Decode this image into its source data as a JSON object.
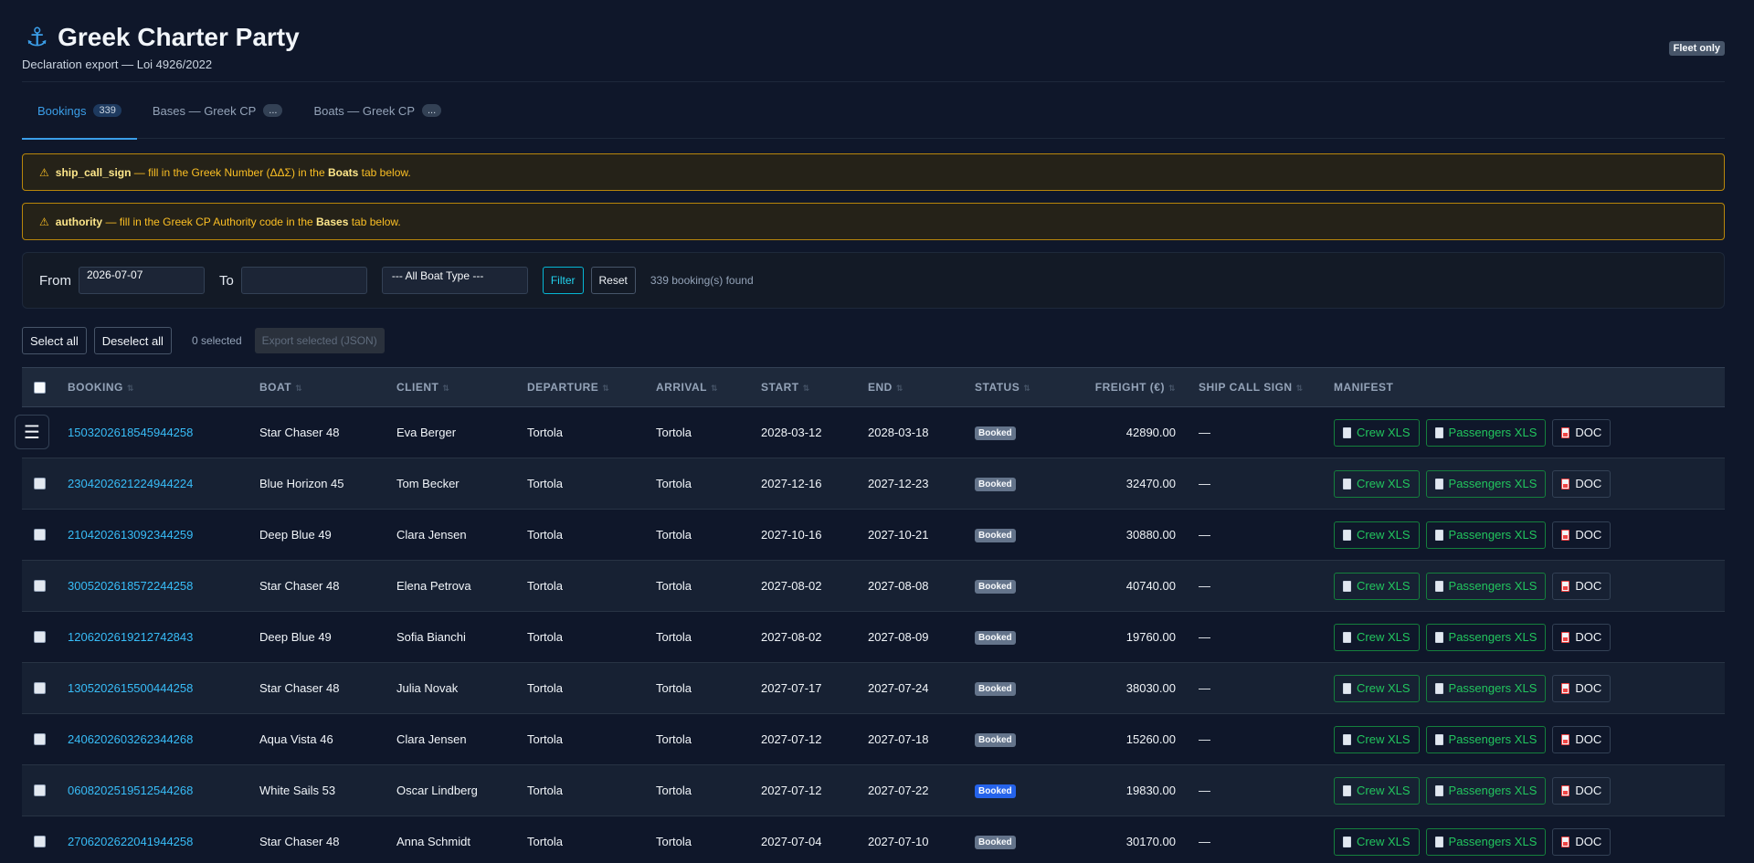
{
  "header": {
    "title": "Greek Charter Party",
    "subtitle": "Declaration export — Loi 4926/2022",
    "badge": "Fleet only",
    "icon": "anchor-icon"
  },
  "tabs": [
    {
      "label": "Bookings",
      "count": "339"
    },
    {
      "label": "Bases — Greek CP",
      "count": "..."
    },
    {
      "label": "Boats — Greek CP",
      "count": "..."
    }
  ],
  "warnings": [
    {
      "field": "ship_call_sign",
      "text_before": " — fill in the Greek Number (ΔΔΣ) in the ",
      "target": "Boats",
      "text_after": " tab below."
    },
    {
      "field": "authority",
      "text_before": " — fill in the Greek CP Authority code in the ",
      "target": "Bases",
      "text_after": " tab below."
    }
  ],
  "filter": {
    "from_label": "From",
    "from_value": "2026-07-07",
    "to_label": "To",
    "to_value": "",
    "boat_type": "--- All Boat Type ---",
    "filter_label": "Filter",
    "reset_label": "Reset",
    "found": "339 booking(s) found"
  },
  "selection": {
    "select_all": "Select all",
    "deselect_all": "Deselect all",
    "selected": "0 selected",
    "export": "Export selected (JSON)"
  },
  "table": {
    "headers": {
      "booking": "BOOKING",
      "boat": "BOAT",
      "client": "CLIENT",
      "departure": "DEPARTURE",
      "arrival": "ARRIVAL",
      "start": "START",
      "end": "END",
      "status": "STATUS",
      "freight": "FREIGHT (€)",
      "sign": "SHIP CALL SIGN",
      "manifest": "MANIFEST"
    },
    "manifest_labels": {
      "crew": "Crew XLS",
      "passengers": "Passengers XLS",
      "doc": "DOC"
    },
    "rows": [
      {
        "booking": "1503202618545944258",
        "boat": "Star Chaser 48",
        "client": "Eva Berger",
        "departure": "Tortola",
        "arrival": "Tortola",
        "start": "2028-03-12",
        "end": "2028-03-18",
        "status": "Booked",
        "status_color": "#64748b",
        "freight": "42890.00",
        "sign": "—"
      },
      {
        "booking": "2304202621224944224",
        "boat": "Blue Horizon 45",
        "client": "Tom Becker",
        "departure": "Tortola",
        "arrival": "Tortola",
        "start": "2027-12-16",
        "end": "2027-12-23",
        "status": "Booked",
        "status_color": "#64748b",
        "freight": "32470.00",
        "sign": "—"
      },
      {
        "booking": "2104202613092344259",
        "boat": "Deep Blue 49",
        "client": "Clara Jensen",
        "departure": "Tortola",
        "arrival": "Tortola",
        "start": "2027-10-16",
        "end": "2027-10-21",
        "status": "Booked",
        "status_color": "#64748b",
        "freight": "30880.00",
        "sign": "—"
      },
      {
        "booking": "3005202618572244258",
        "boat": "Star Chaser 48",
        "client": "Elena Petrova",
        "departure": "Tortola",
        "arrival": "Tortola",
        "start": "2027-08-02",
        "end": "2027-08-08",
        "status": "Booked",
        "status_color": "#64748b",
        "freight": "40740.00",
        "sign": "—"
      },
      {
        "booking": "1206202619212742843",
        "boat": "Deep Blue 49",
        "client": "Sofia Bianchi",
        "departure": "Tortola",
        "arrival": "Tortola",
        "start": "2027-08-02",
        "end": "2027-08-09",
        "status": "Booked",
        "status_color": "#64748b",
        "freight": "19760.00",
        "sign": "—"
      },
      {
        "booking": "1305202615500444258",
        "boat": "Star Chaser 48",
        "client": "Julia Novak",
        "departure": "Tortola",
        "arrival": "Tortola",
        "start": "2027-07-17",
        "end": "2027-07-24",
        "status": "Booked",
        "status_color": "#64748b",
        "freight": "38030.00",
        "sign": "—"
      },
      {
        "booking": "2406202603262344268",
        "boat": "Aqua Vista 46",
        "client": "Clara Jensen",
        "departure": "Tortola",
        "arrival": "Tortola",
        "start": "2027-07-12",
        "end": "2027-07-18",
        "status": "Booked",
        "status_color": "#64748b",
        "freight": "15260.00",
        "sign": "—"
      },
      {
        "booking": "0608202519512544268",
        "boat": "White Sails 53",
        "client": "Oscar Lindberg",
        "departure": "Tortola",
        "arrival": "Tortola",
        "start": "2027-07-12",
        "end": "2027-07-22",
        "status": "Booked",
        "status_color": "#2563eb",
        "freight": "19830.00",
        "sign": "—"
      },
      {
        "booking": "2706202622041944258",
        "boat": "Star Chaser 48",
        "client": "Anna Schmidt",
        "departure": "Tortola",
        "arrival": "Tortola",
        "start": "2027-07-04",
        "end": "2027-07-10",
        "status": "Booked",
        "status_color": "#64748b",
        "freight": "30170.00",
        "sign": "—"
      }
    ]
  },
  "menu_icon": "hamburger-icon"
}
